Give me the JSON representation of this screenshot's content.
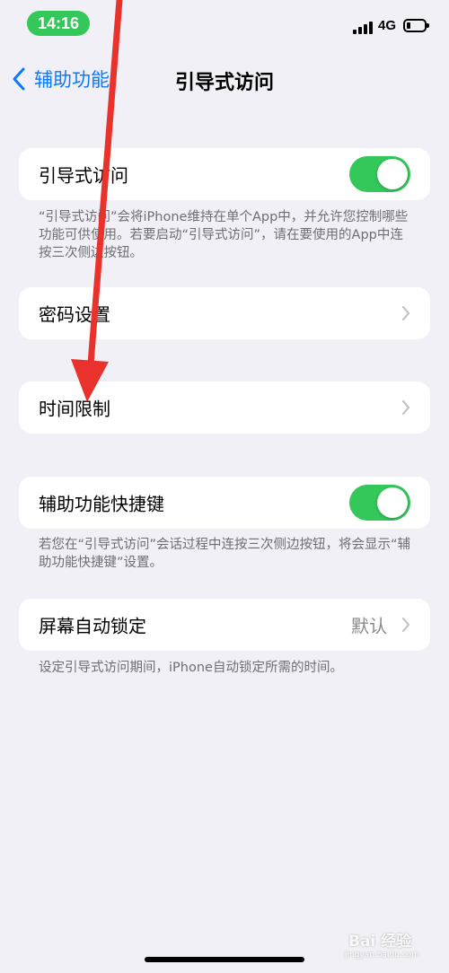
{
  "status_bar": {
    "time": "14:16",
    "network": "4G",
    "signal_icon": "cellular-signal-icon",
    "battery_icon": "battery-icon",
    "battery_level": 0.2
  },
  "nav": {
    "back_label": "辅助功能",
    "title": "引导式访问"
  },
  "sections": {
    "guided_access": {
      "label": "引导式访问",
      "toggle_on": true,
      "footer": "“引导式访问”会将iPhone维持在单个App中，并允许您控制哪些功能可供使用。若要启动“引导式访问”，请在要使用的App中连按三次侧边按钮。"
    },
    "passcode": {
      "label": "密码设置"
    },
    "time_limits": {
      "label": "时间限制"
    },
    "accessibility_shortcut": {
      "label": "辅助功能快捷键",
      "toggle_on": true,
      "footer": "若您在“引导式访问”会话过程中连按三次侧边按钮，将会显示“辅助功能快捷键”设置。"
    },
    "auto_lock": {
      "label": "屏幕自动锁定",
      "value": "默认",
      "footer": "设定引导式访问期间，iPhone自动锁定所需的时间。"
    }
  },
  "colors": {
    "accent": "#0a7aff",
    "toggle_on": "#34c759",
    "annotation_arrow": "#e8322b",
    "background": "#f1f0f6"
  },
  "watermark": {
    "text": "Bai 经验",
    "sub": "jingyan.baidu.com"
  }
}
